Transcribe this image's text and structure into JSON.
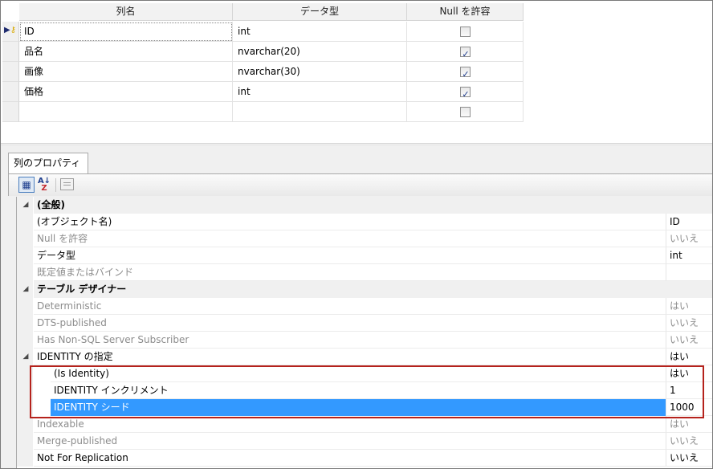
{
  "grid": {
    "headers": {
      "name": "列名",
      "type": "データ型",
      "nulls": "Null を許容"
    },
    "rows": [
      {
        "name": "ID",
        "type": "int",
        "allow_null": false,
        "selected": true,
        "primary_key": true
      },
      {
        "name": "品名",
        "type": "nvarchar(20)",
        "allow_null": true
      },
      {
        "name": "画像",
        "type": "nvarchar(30)",
        "allow_null": true
      },
      {
        "name": "価格",
        "type": "int",
        "allow_null": true
      },
      {
        "name": "",
        "type": "",
        "allow_null": false
      }
    ]
  },
  "properties": {
    "tab_label": "列のプロパティ",
    "toolbar": {
      "categorized_icon": "categorized-icon",
      "alphabetical_icon": "alphabetical-sort-icon",
      "property_pages_icon": "property-pages-icon"
    },
    "rows": [
      {
        "kind": "category",
        "name": "(全般)",
        "value": ""
      },
      {
        "kind": "prop",
        "name": "(オブジェクト名)",
        "value": "ID",
        "dim": false
      },
      {
        "kind": "prop",
        "name": "Null を許容",
        "value": "いいえ",
        "dim": true
      },
      {
        "kind": "prop",
        "name": "データ型",
        "value": "int",
        "dim": false
      },
      {
        "kind": "prop",
        "name": "既定値またはバインド",
        "value": "",
        "dim": true
      },
      {
        "kind": "category",
        "name": "テーブル デザイナー",
        "value": ""
      },
      {
        "kind": "prop",
        "name": "Deterministic",
        "value": "はい",
        "dim": true
      },
      {
        "kind": "prop",
        "name": "DTS-published",
        "value": "いいえ",
        "dim": true
      },
      {
        "kind": "prop",
        "name": "Has Non-SQL Server Subscriber",
        "value": "いいえ",
        "dim": true
      },
      {
        "kind": "expandable",
        "name": "IDENTITY の指定",
        "value": "はい",
        "dim": false
      },
      {
        "kind": "child",
        "name": "(Is Identity)",
        "value": "はい",
        "dim": false
      },
      {
        "kind": "child",
        "name": "IDENTITY インクリメント",
        "value": "1",
        "dim": false
      },
      {
        "kind": "child",
        "name": "IDENTITY シード",
        "value": "1000",
        "dim": false,
        "selected": true
      },
      {
        "kind": "prop",
        "name": "Indexable",
        "value": "はい",
        "dim": true
      },
      {
        "kind": "prop",
        "name": "Merge-published",
        "value": "いいえ",
        "dim": true
      },
      {
        "kind": "prop",
        "name": "Not For Replication",
        "value": "いいえ",
        "dim": false
      }
    ]
  },
  "colors": {
    "selection": "#3399ff",
    "annotation_box": "#b5221c",
    "panel_bg": "#f0f0f0"
  }
}
